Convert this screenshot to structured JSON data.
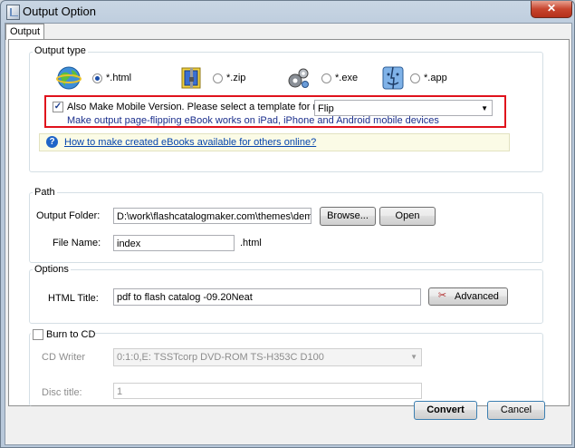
{
  "window": {
    "title": "Output Option",
    "close_glyph": "✕"
  },
  "tab": {
    "label": "Output"
  },
  "output_type": {
    "legend": "Output type",
    "options": [
      {
        "label": "*.html",
        "selected": true,
        "icon": "globe-icon"
      },
      {
        "label": "*.zip",
        "selected": false,
        "icon": "zip-archive-icon"
      },
      {
        "label": "*.exe",
        "selected": false,
        "icon": "gears-icon"
      },
      {
        "label": "*.app",
        "selected": false,
        "icon": "mac-finder-icon"
      }
    ],
    "mobile": {
      "checked": true,
      "check_glyph": "✓",
      "label": "Also Make Mobile Version. Please select a template for mobile:",
      "template": "Flip",
      "hint": "Make output page-flipping eBook works on iPad, iPhone and Android mobile devices"
    },
    "help_glyph": "?",
    "help_link": "How to make created eBooks available for others online?"
  },
  "path": {
    "legend": "Path",
    "output_folder_label": "Output Folder:",
    "output_folder_value": "D:\\work\\flashcatalogmaker.com\\themes\\demo\\flash",
    "browse_label": "Browse...",
    "open_label": "Open",
    "file_name_label": "File Name:",
    "file_name_value": "index",
    "extension": ".html"
  },
  "options": {
    "legend": "Options",
    "html_title_label": "HTML Title:",
    "html_title_value": "pdf to flash catalog -09.20Neat",
    "advanced_label": "Advanced"
  },
  "burn": {
    "label": "Burn to CD",
    "checked": false,
    "cd_writer_label": "CD Writer",
    "cd_writer_value": "0:1:0,E: TSSTcorp DVD-ROM TS-H353C D100",
    "disc_title_label": "Disc title:",
    "disc_title_value": "1"
  },
  "footer": {
    "convert_label": "Convert",
    "cancel_label": "Cancel"
  },
  "colors": {
    "highlight_border": "#e0121c",
    "hint_text": "#1a2e8c",
    "link": "#0645ad"
  }
}
